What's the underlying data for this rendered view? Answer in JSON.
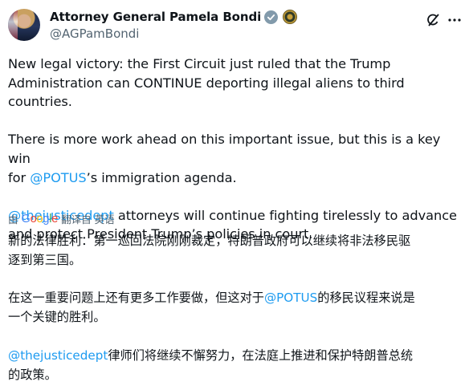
{
  "author": {
    "name": "Attorney General Pamela Bondi",
    "handle": "@AGPamBondi"
  },
  "tweet": {
    "p1": "New legal victory: the First Circuit just ruled that the Trump\nAdministration can CONTINUE deporting illegal aliens to third countries.",
    "p2_a": "There is more work ahead on this important issue, but this is a key win\nfor ",
    "p2_mention": "@POTUS",
    "p2_b": "’s immigration agenda.",
    "p3_mention": "@thejusticedept",
    "p3_b": " attorneys will continue fighting tirelessly to advance\nand protect President Trump’s policies in court."
  },
  "translation": {
    "by": "由",
    "google": [
      "G",
      "o",
      "o",
      "g",
      "l",
      "e"
    ],
    "label": "翻译自 英语"
  },
  "zh": {
    "p1": "新的法律胜利：第一巡回法院刚刚裁定，特朗普政府可以继续将非法移民驱\n逐到第三国。",
    "p2_a": "在这一重要问题上还有更多工作要做，但这对于",
    "p2_mention": "@POTUS",
    "p2_b": "的移民议程来说是\n一个关键的胜利。",
    "p3_mention": "@thejusticedept",
    "p3_b": "律师们将继续不懈努力，在法庭上推进和保护特朗普总统\n的政策。"
  },
  "icons": [
    "verified-badge-icon",
    "seal-icon",
    "grok-icon",
    "more-options-icon"
  ],
  "colors": {
    "link": "#1d9bf0",
    "text": "#0f1419",
    "muted": "#536471",
    "badge": "#829aab"
  }
}
